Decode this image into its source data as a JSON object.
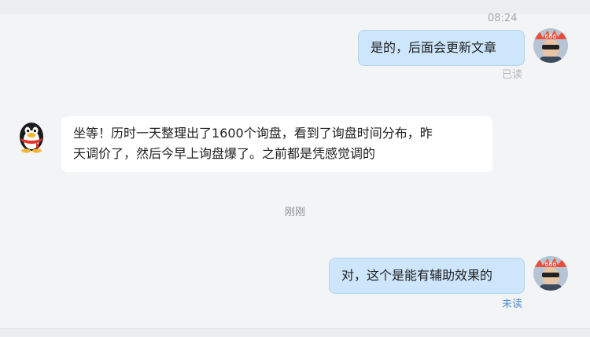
{
  "chat": {
    "time_top": "08:24",
    "center_timestamp": "刚刚",
    "messages": [
      {
        "sender": "me",
        "text": "是的，后面会更新文章",
        "status": "已读"
      },
      {
        "sender": "them",
        "line1": "坐等！历时一天整理出了1600个询盘，看到了询盘时间分布，昨",
        "line2": "天调价了，然后今早上询盘爆了。之前都是凭感觉调的"
      },
      {
        "sender": "me",
        "text": "对，这个是能有辅助效果的",
        "status": "未读"
      }
    ]
  },
  "colors": {
    "background": "#f3f4f6",
    "my_bubble": "#cde6fb",
    "their_bubble": "#ffffff",
    "read_status": "#b1b5ba",
    "unread_status": "#4a8ed6"
  },
  "icons": {
    "my_avatar": "user-avatar-sunglasses",
    "their_avatar": "qq-penguin-avatar"
  }
}
